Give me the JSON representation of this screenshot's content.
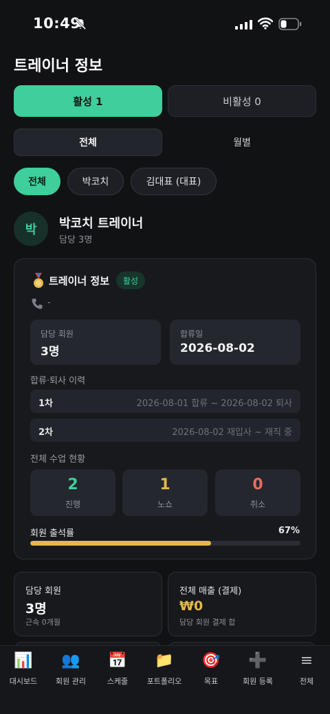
{
  "status_bar": {
    "time": "10:49"
  },
  "page_title": "트레이너 정보",
  "status_tabs": [
    {
      "label": "활성 1",
      "active": true
    },
    {
      "label": "비활성 0",
      "active": false
    }
  ],
  "period_tabs": [
    {
      "label": "전체",
      "active": true
    },
    {
      "label": "월별",
      "active": false
    }
  ],
  "trainer_chips": [
    {
      "label": "전체",
      "active": true
    },
    {
      "label": "박코치",
      "active": false
    },
    {
      "label": "김대표 (대표)",
      "active": false
    }
  ],
  "trainer": {
    "avatar_text": "박",
    "name": "박코치 트레이너",
    "subtitle": "담당 3명"
  },
  "info_card": {
    "title": "트레이너 정보",
    "badge": "활성",
    "phone": "-",
    "members_label": "담당 회원",
    "members_value": "3명",
    "join_label": "합류일",
    "join_value": "2026-08-02",
    "history_label": "합류·퇴사 이력",
    "history": [
      {
        "order": "1차",
        "text": "2026-08-01 합류 ~ 2026-08-02 퇴사"
      },
      {
        "order": "2차",
        "text": "2026-08-02 재입사 ~ 재직 중"
      }
    ],
    "class_status_label": "전체 수업 현황",
    "stats": [
      {
        "value": "2",
        "label": "진행",
        "color": "#3ecf9c"
      },
      {
        "value": "1",
        "label": "노쇼",
        "color": "#e4b84b"
      },
      {
        "value": "0",
        "label": "취소",
        "color": "#e36d62"
      }
    ],
    "attendance_label": "회원 출석률",
    "attendance_value": "67%",
    "attendance_fraction": 0.67
  },
  "summary_cards": [
    {
      "label": "담당 회원",
      "value": "3명",
      "sub": "근속 0개월",
      "value_color": "#ffffff"
    },
    {
      "label": "전체 매출 (결제)",
      "value": "₩0",
      "sub": "담당 회원 결제 합",
      "value_color": "#e4b84b"
    }
  ],
  "bottom_nav": [
    {
      "icon": "chart-icon",
      "glyph": "📊",
      "label": "대시보드"
    },
    {
      "icon": "members-icon",
      "glyph": "👥",
      "label": "회원 관리"
    },
    {
      "icon": "calendar-icon",
      "glyph": "📅",
      "label": "스케줄"
    },
    {
      "icon": "folder-icon",
      "glyph": "📁",
      "label": "포트폴리오"
    },
    {
      "icon": "target-icon",
      "glyph": "🎯",
      "label": "목표"
    },
    {
      "icon": "plus-icon",
      "glyph": "➕",
      "label": "회원 등록"
    },
    {
      "icon": "menu-icon",
      "glyph": "≡",
      "label": "전체"
    }
  ]
}
